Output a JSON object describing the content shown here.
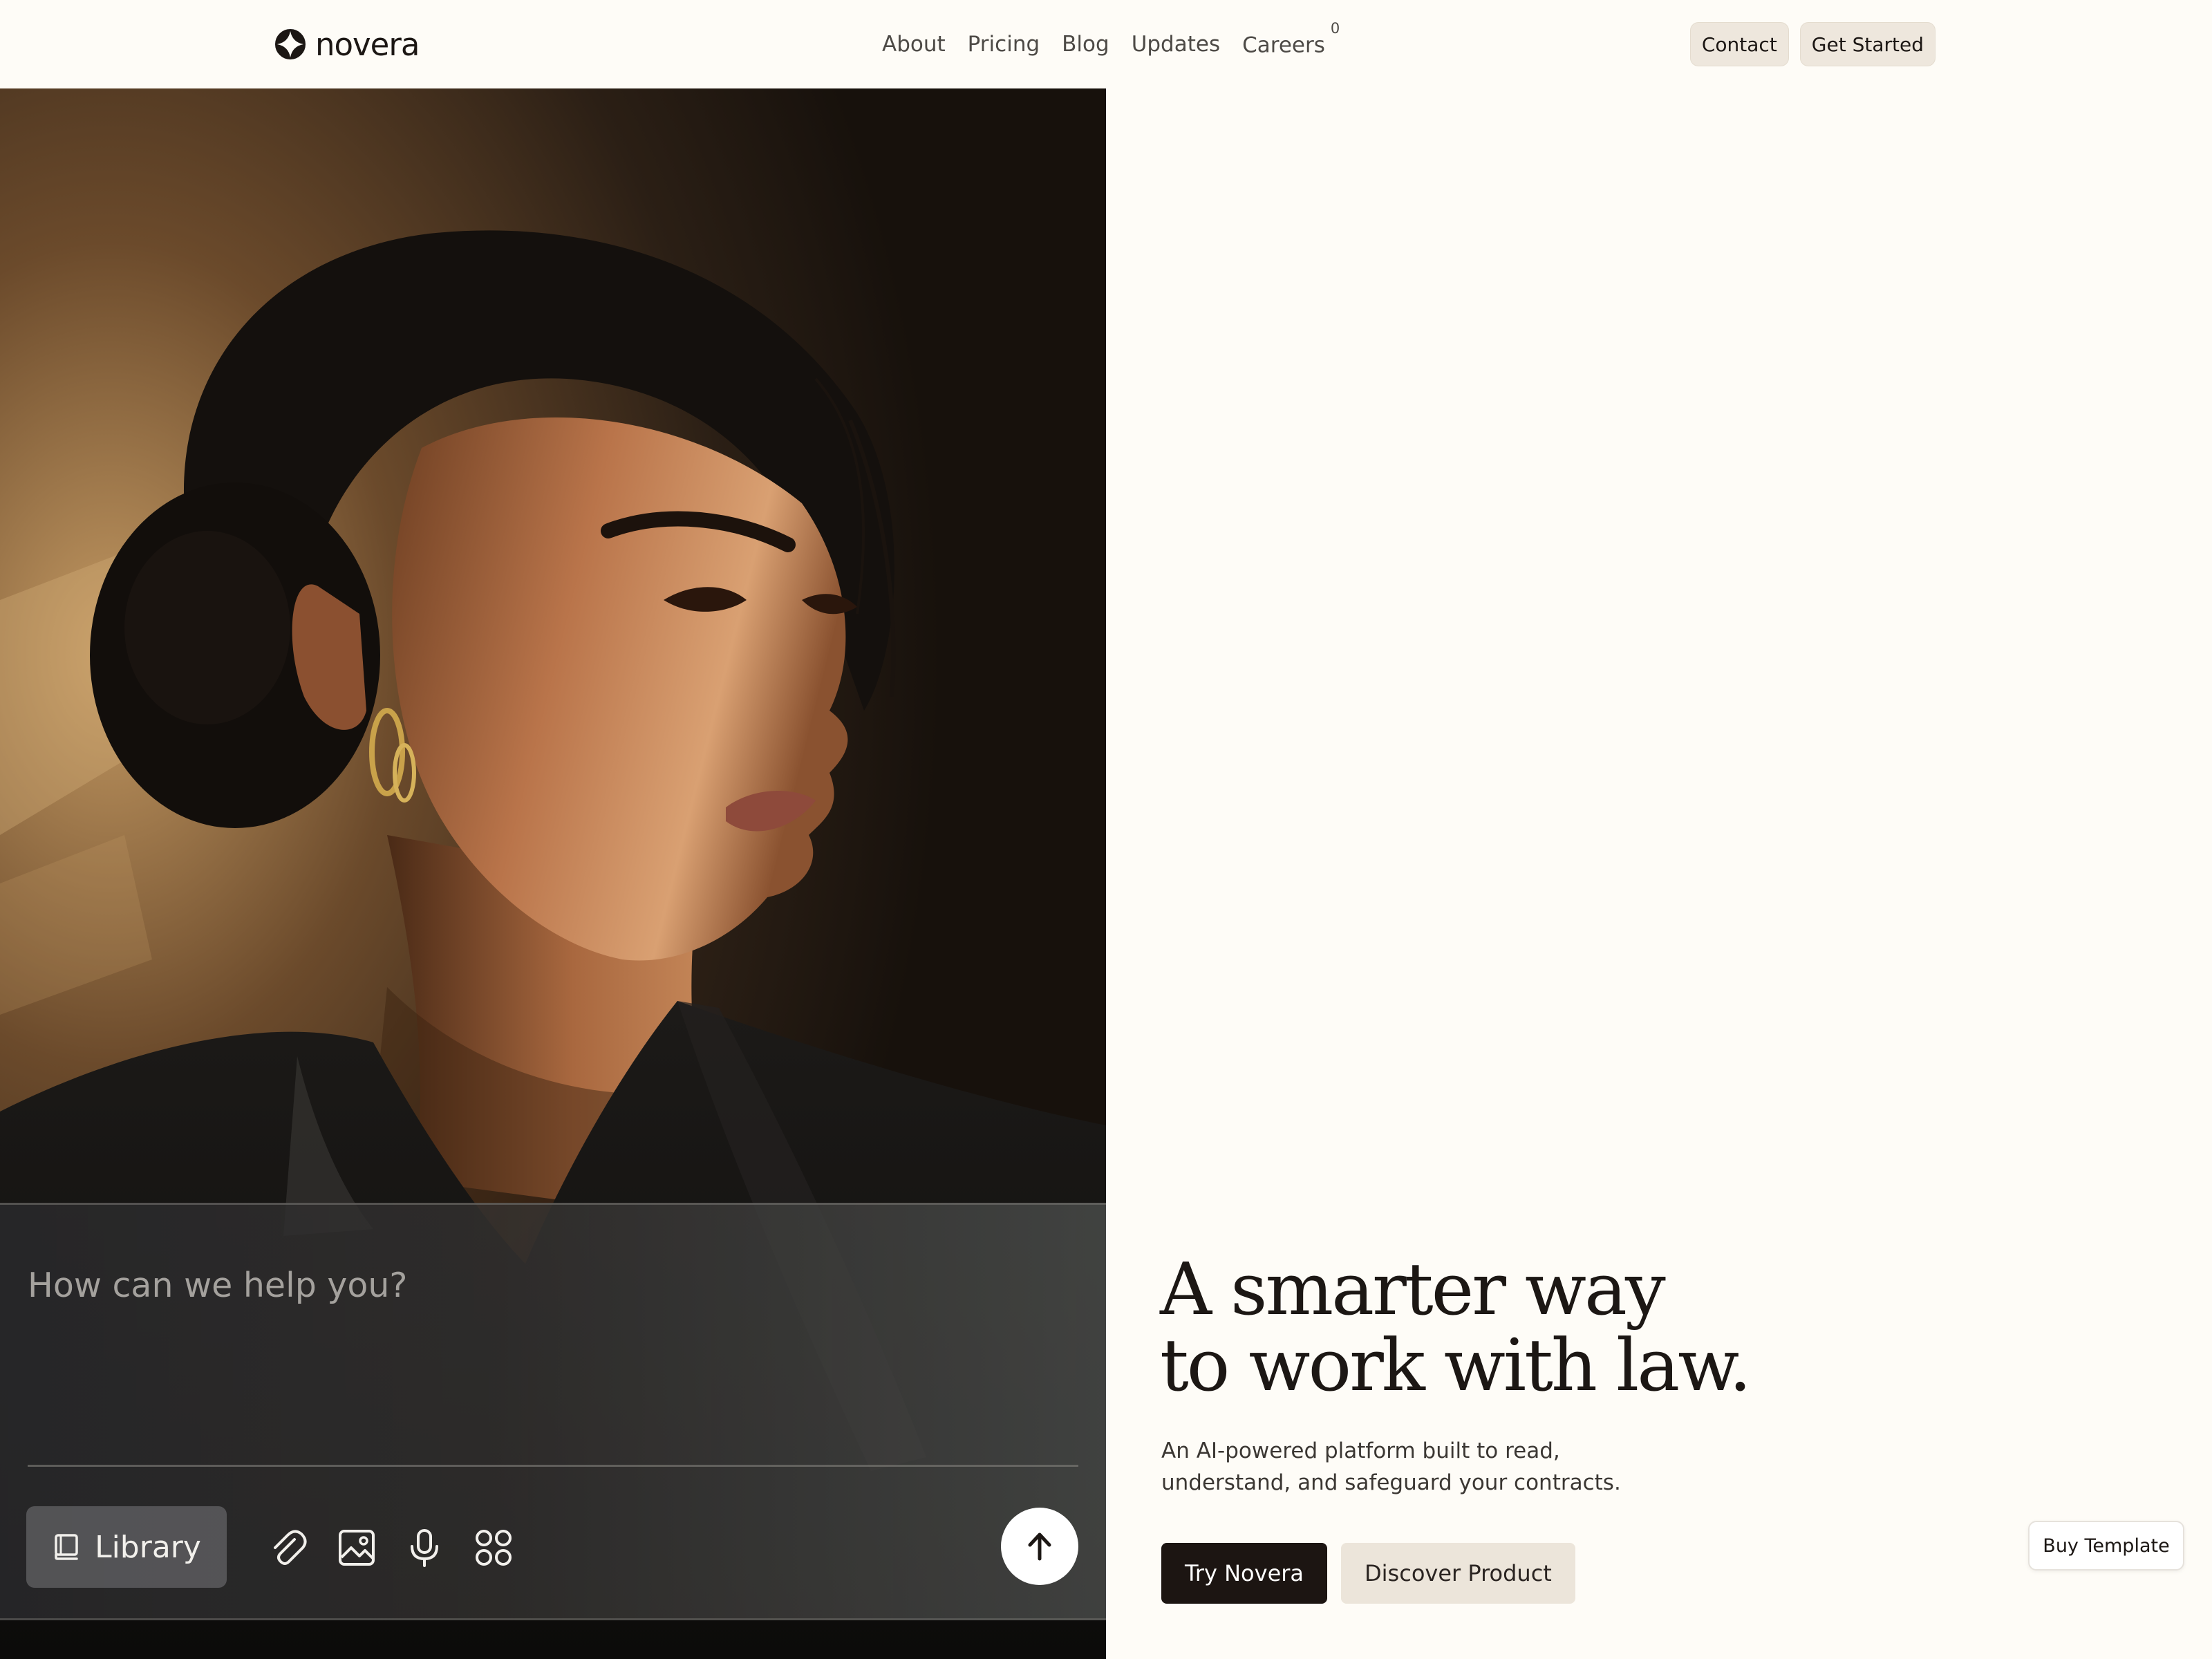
{
  "brand": {
    "name": "novera",
    "logo_icon": "four-petal-logo-icon"
  },
  "nav": {
    "items": [
      {
        "label": "About"
      },
      {
        "label": "Pricing"
      },
      {
        "label": "Blog"
      },
      {
        "label": "Updates"
      },
      {
        "label": "Careers",
        "badge": "0"
      }
    ]
  },
  "header_buttons": {
    "contact": "Contact",
    "get_started": "Get Started"
  },
  "composer": {
    "placeholder": "How can we help you?",
    "library_label": "Library",
    "tools": [
      "paperclip-icon",
      "image-icon",
      "microphone-icon",
      "apps-grid-icon"
    ],
    "send_icon": "arrow-up-icon"
  },
  "hero": {
    "headline_line1": "A smarter way",
    "headline_line2": "to work with law.",
    "subtext_line1": "An AI-powered platform built to read,",
    "subtext_line2": "understand, and safeguard your contracts.",
    "cta_primary": "Try Novera",
    "cta_secondary": "Discover Product"
  },
  "floating": {
    "buy_template": "Buy Template"
  },
  "colors": {
    "page_background": "#fefcf7",
    "primary_dark": "#1c1512",
    "secondary_button": "#ece5da"
  }
}
